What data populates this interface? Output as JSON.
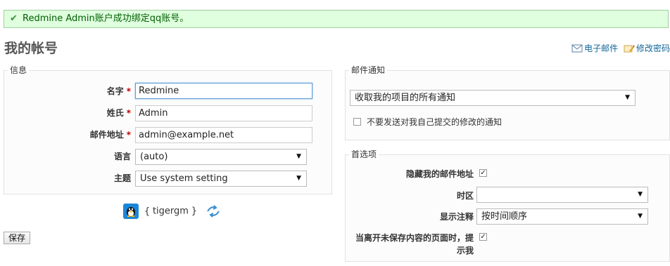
{
  "flash": {
    "message": "Redmine Admin账户成功绑定qq账号。"
  },
  "page_title": "我的帐号",
  "contextual": {
    "email_label": "电子邮件",
    "password_label": "修改密码"
  },
  "info": {
    "legend": "信息",
    "firstname": {
      "label": "名字",
      "value": "Redmine",
      "required": "*"
    },
    "lastname": {
      "label": "姓氏",
      "value": "Admin",
      "required": "*"
    },
    "mail": {
      "label": "邮件地址",
      "value": "admin@example.net",
      "required": "*"
    },
    "language": {
      "label": "语言",
      "value": "(auto)"
    },
    "theme": {
      "label": "主题",
      "value": "Use system setting"
    }
  },
  "qq": {
    "open": "{",
    "name": "tigergm",
    "close": "}"
  },
  "save_label": "保存",
  "mail_notification": {
    "legend": "邮件通知",
    "value": "收取我的项目的所有通知",
    "no_self_notified": {
      "label": "不要发送对我自己提交的修改的通知",
      "checked": false
    }
  },
  "preferences": {
    "legend": "首选项",
    "hide_mail": {
      "label": "隐藏我的邮件地址",
      "checked": true
    },
    "timezone": {
      "label": "时区",
      "value": ""
    },
    "comments_sorting": {
      "label": "显示注释",
      "value": "按时间顺序"
    },
    "warn_unsaved": {
      "label_line1": "当离开未保存内容的页面时，提",
      "label_line2": "示我",
      "checked": true
    }
  }
}
